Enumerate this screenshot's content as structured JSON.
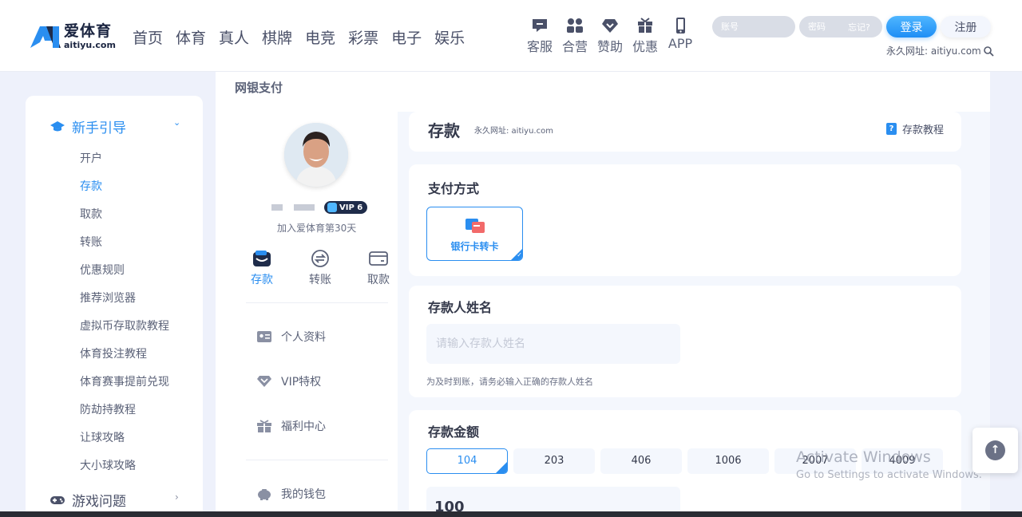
{
  "header": {
    "logo_cn": "爱体育",
    "logo_en": "aitiyu.com",
    "nav": [
      "首页",
      "体育",
      "真人",
      "棋牌",
      "电竞",
      "彩票",
      "电子",
      "娱乐"
    ],
    "quick": [
      {
        "label": "客服",
        "icon": "chat-icon"
      },
      {
        "label": "合营",
        "icon": "partner-icon"
      },
      {
        "label": "赞助",
        "icon": "sponsor-icon"
      },
      {
        "label": "优惠",
        "icon": "gift-icon"
      },
      {
        "label": "APP",
        "icon": "phone-icon"
      }
    ],
    "account_placeholder": "账号",
    "password_placeholder": "密码",
    "forgot": "忘记?",
    "login": "登录",
    "register": "注册",
    "perm_url": "永久网址: aitiyu.com"
  },
  "sidebar": {
    "group1": "新手引导",
    "items": [
      "开户",
      "存款",
      "取款",
      "转账",
      "优惠规则",
      "推荐浏览器",
      "虚拟币存取款教程",
      "体育投注教程",
      "体育赛事提前兑现",
      "防劫持教程",
      "让球攻略",
      "大小球攻略"
    ],
    "active_index": 1,
    "group2": "游戏问题"
  },
  "main": {
    "title": "网银支付",
    "profile": {
      "vip": "VIP 6",
      "join": "加入爱体育第30天",
      "actions": [
        "存款",
        "转账",
        "取款"
      ],
      "menu": [
        "个人资料",
        "VIP特权",
        "福利中心",
        "我的钱包"
      ]
    },
    "deposit": {
      "heading": "存款",
      "url": "永久网址: aitiyu.com",
      "tutorial": "存款教程",
      "pay_title": "支付方式",
      "pay_option": "银行卡转卡",
      "name_title": "存款人姓名",
      "name_placeholder": "请输入存款人姓名",
      "name_hint": "为及时到账，请务必输入正确的存款人姓名",
      "amount_title": "存款金额",
      "amounts": [
        "104",
        "203",
        "406",
        "1006",
        "2007",
        "4009"
      ],
      "amount_value": "100"
    }
  },
  "watermark": {
    "line1": "Activate Windows",
    "line2": "Go to Settings to activate Windows."
  },
  "colors": {
    "accent": "#2a8ef0",
    "dark": "#1f2c4a",
    "bg": "#eef1fb"
  }
}
